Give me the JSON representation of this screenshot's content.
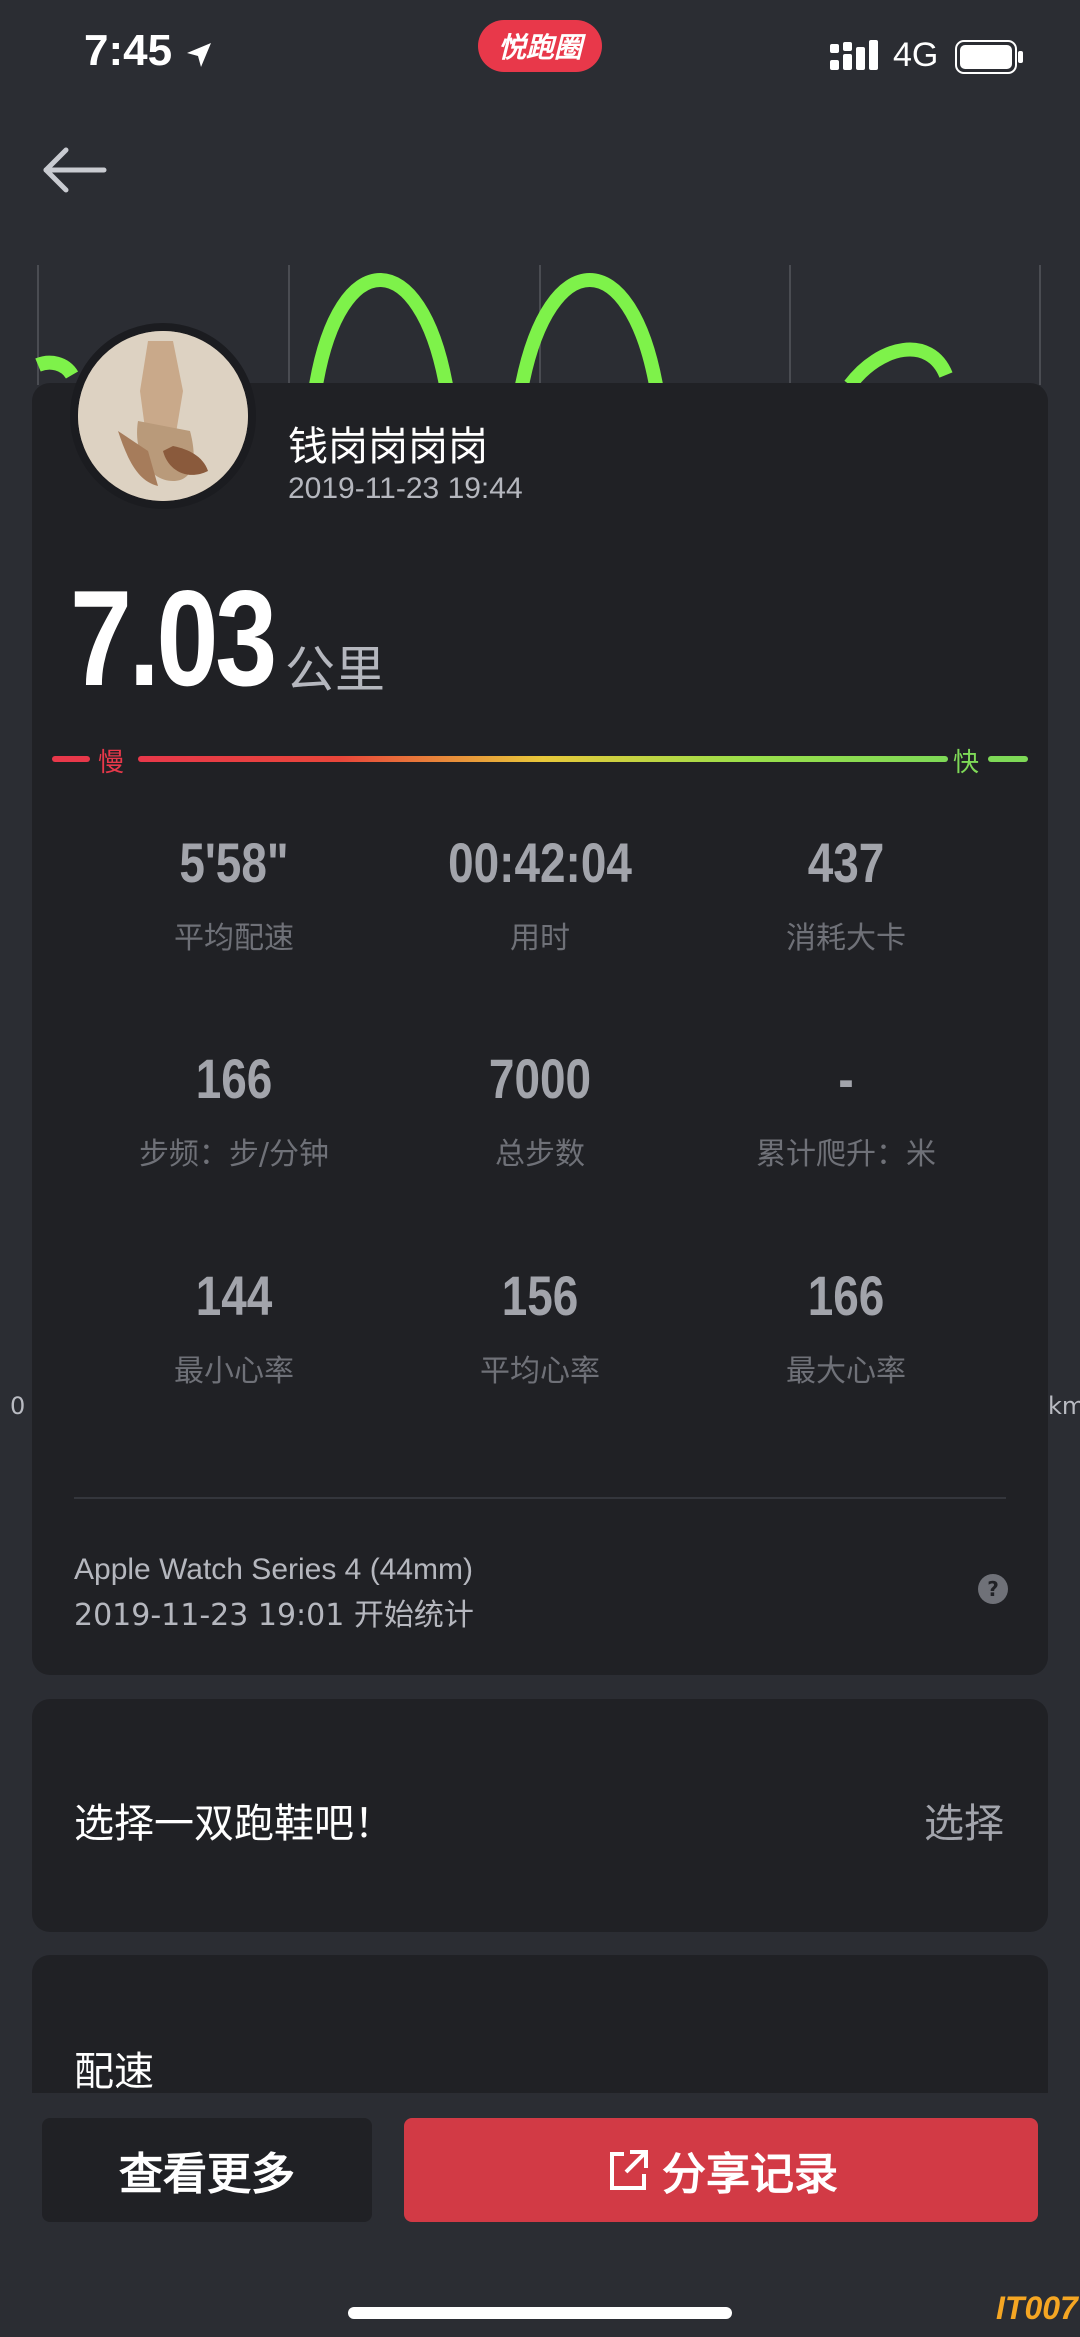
{
  "status_bar": {
    "time": "7:45",
    "app_badge": "悦跑圈",
    "network": "4G"
  },
  "chart_axis": {
    "left_label": "0",
    "right_label": "km"
  },
  "profile": {
    "username": "钱岗岗岗岗",
    "datetime": "2019-11-23 19:44"
  },
  "distance": {
    "value": "7.03",
    "unit": "公里"
  },
  "pace_scale": {
    "slow": "慢",
    "fast": "快"
  },
  "stats": [
    {
      "value": "5'58\"",
      "label": "平均配速"
    },
    {
      "value": "00:42:04",
      "label": "用时"
    },
    {
      "value": "437",
      "label": "消耗大卡"
    },
    {
      "value": "166",
      "label": "步频：步/分钟"
    },
    {
      "value": "7000",
      "label": "总步数"
    },
    {
      "value": "-",
      "label": "累计爬升：米"
    },
    {
      "value": "144",
      "label": "最小心率"
    },
    {
      "value": "156",
      "label": "平均心率"
    },
    {
      "value": "166",
      "label": "最大心率"
    }
  ],
  "device": {
    "name": "Apple Watch Series 4 (44mm)",
    "start": "2019-11-23 19:01 开始统计",
    "help": "?"
  },
  "shoe": {
    "prompt": "选择一双跑鞋吧！",
    "action": "选择"
  },
  "pace_section": {
    "title": "配速"
  },
  "bottom": {
    "more_label": "查看更多",
    "share_label": "分享记录"
  },
  "watermark": "IT007",
  "colors": {
    "accent_red": "#d23a45",
    "pace_green": "#7ed957",
    "pace_red": "#e8384a"
  }
}
